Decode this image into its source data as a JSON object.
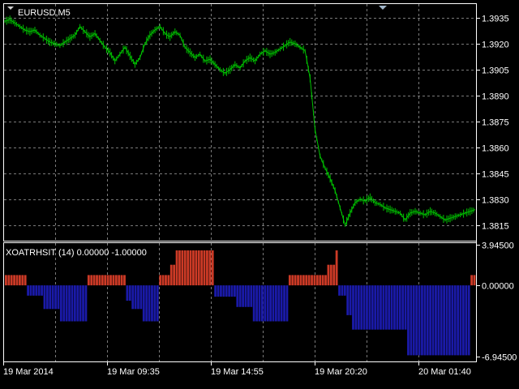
{
  "main_panel": {
    "symbol_label": "EURUSD,M5",
    "price_ticks": [
      "1.3935",
      "1.3920",
      "1.3905",
      "1.3890",
      "1.3875",
      "1.3860",
      "1.3845",
      "1.3830",
      "1.3815"
    ],
    "price_values": [
      1.3935,
      1.392,
      1.3905,
      1.389,
      1.3875,
      1.386,
      1.3845,
      1.383,
      1.3815
    ],
    "ylim": [
      1.3806,
      1.3943
    ],
    "grid": true,
    "candle_color": "#00c000"
  },
  "indicator_panel": {
    "label": "XOATRHSIT (14) 0.00000 -1.00000",
    "ticks": [
      "3.94500",
      "0.00000",
      "-6.94500"
    ],
    "tick_values": [
      3.945,
      0.0,
      -6.945
    ],
    "ylim": [
      -7.4,
      4.1
    ],
    "positive_color": "#cc3a26",
    "negative_color": "#1a1aa8"
  },
  "time_axis": {
    "labels": [
      "19 Mar 2014",
      "19 Mar 09:35",
      "19 Mar 14:55",
      "19 Mar 20:20",
      "20 Mar 01:40"
    ]
  },
  "chart_data": {
    "type": "line",
    "title": "EURUSD,M5",
    "x_labels": [
      "19 Mar 2014",
      "19 Mar 09:35",
      "19 Mar 14:55",
      "19 Mar 20:20",
      "20 Mar 01:40"
    ],
    "series": [
      {
        "name": "EURUSD,M5",
        "values": [
          1.3933,
          1.3934,
          1.3932,
          1.393,
          1.3928,
          1.3927,
          1.3928,
          1.3925,
          1.3923,
          1.3921,
          1.392,
          1.3919,
          1.3921,
          1.3923,
          1.3925,
          1.393,
          1.3927,
          1.3924,
          1.3926,
          1.3922,
          1.3918,
          1.3915,
          1.391,
          1.3914,
          1.3918,
          1.3913,
          1.3908,
          1.3912,
          1.392,
          1.3925,
          1.3928,
          1.393,
          1.3926,
          1.3924,
          1.3927,
          1.3925,
          1.3918,
          1.3915,
          1.3912,
          1.3914,
          1.391,
          1.3911,
          1.3908,
          1.3905,
          1.3903,
          1.3905,
          1.3908,
          1.3906,
          1.391,
          1.3912,
          1.391,
          1.3914,
          1.3916,
          1.3914,
          1.3915,
          1.3917,
          1.3919,
          1.3921,
          1.392,
          1.3918,
          1.3916,
          1.39,
          1.387,
          1.3855,
          1.3848,
          1.3842,
          1.3835,
          1.3825,
          1.3815,
          1.3822,
          1.3828,
          1.383,
          1.3829,
          1.3831,
          1.3828,
          1.3827,
          1.3825,
          1.3824,
          1.3823,
          1.3822,
          1.3818,
          1.3822,
          1.3823,
          1.3822,
          1.3821,
          1.3823,
          1.3822,
          1.382,
          1.3818,
          1.3819,
          1.382,
          1.3821,
          1.3822,
          1.3823,
          1.3824
        ]
      },
      {
        "name": "XOATRHSIT (14)",
        "values": [
          1.0,
          1.0,
          1.0,
          1.0,
          1.0,
          1.0,
          1.0,
          1.0,
          -1.0,
          -1.0,
          -1.0,
          -1.0,
          -1.0,
          -1.0,
          -2.3,
          -2.3,
          -2.3,
          -2.3,
          -2.3,
          -2.3,
          -3.5,
          -3.5,
          -3.5,
          -3.5,
          -3.5,
          -3.5,
          -3.5,
          -3.5,
          -3.5,
          -3.5,
          1.0,
          1.0,
          1.0,
          1.0,
          1.0,
          1.0,
          1.0,
          1.0,
          1.0,
          1.0,
          1.0,
          1.0,
          1.0,
          1.0,
          -1.5,
          -1.5,
          -2.3,
          -2.3,
          -2.3,
          -2.3,
          -3.5,
          -3.5,
          -3.5,
          -3.5,
          -3.5,
          -3.5,
          1.0,
          1.0,
          1.0,
          1.0,
          2.0,
          2.0,
          3.4,
          3.4,
          3.4,
          3.4,
          3.4,
          3.4,
          3.4,
          3.4,
          3.4,
          3.4,
          3.4,
          3.4,
          3.4,
          3.4,
          -1.1,
          -1.1,
          -1.1,
          -1.1,
          -1.1,
          -1.1,
          -1.1,
          -1.1,
          -2.1,
          -2.1,
          -2.1,
          -2.1,
          -2.1,
          -2.1,
          -3.5,
          -3.5,
          -3.5,
          -3.5,
          -3.5,
          -3.5,
          -3.5,
          -3.5,
          -3.5,
          -3.5,
          -3.5,
          -3.5,
          -3.5,
          1.0,
          1.0,
          1.0,
          1.0,
          1.0,
          1.0,
          1.0,
          1.0,
          1.0,
          1.0,
          1.0,
          1.0,
          1.0,
          1.0,
          2.0,
          2.0,
          2.0,
          3.4,
          -1.0,
          -1.0,
          -1.0,
          -2.9,
          -2.9,
          -4.3,
          -4.3,
          -4.3,
          -4.3,
          -4.3,
          -4.3,
          -4.3,
          -4.3,
          -4.3,
          -4.3,
          -4.3,
          -4.3,
          -4.3,
          -4.3,
          -4.3,
          -4.3,
          -4.3,
          -4.3,
          -4.3,
          -4.3,
          -6.8,
          -6.8,
          -6.8,
          -6.8,
          -6.8,
          -6.8,
          -6.8,
          -6.8,
          -6.8,
          -6.8,
          -6.8,
          -6.8,
          -6.8,
          -6.8,
          -6.8,
          -6.8,
          -6.8,
          -6.8,
          -6.8,
          -6.8,
          -6.8,
          -6.8,
          -6.8,
          1.0,
          1.0
        ]
      }
    ]
  }
}
